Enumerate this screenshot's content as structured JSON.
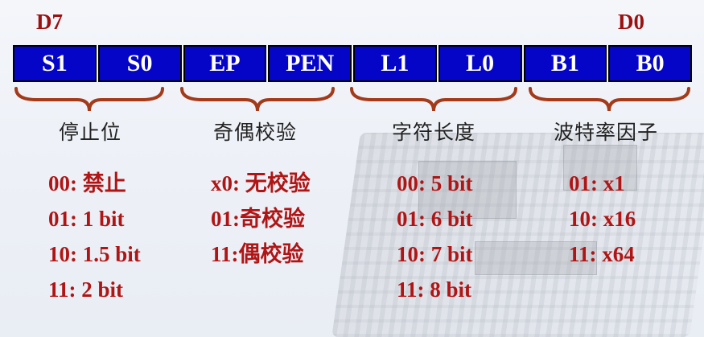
{
  "bit_labels": {
    "high": "D7",
    "low": "D0"
  },
  "register_fields": [
    "S1",
    "S0",
    "EP",
    "PEN",
    "L1",
    "L0",
    "B1",
    "B0"
  ],
  "groups": [
    {
      "title": "停止位",
      "values": [
        "00: 禁止",
        "01: 1 bit",
        "10: 1.5 bit",
        "11: 2 bit"
      ]
    },
    {
      "title": "奇偶校验",
      "values": [
        "x0: 无校验",
        "01:奇校验",
        "11:偶校验"
      ]
    },
    {
      "title": "字符长度",
      "values": [
        "00: 5 bit",
        "01: 6 bit",
        "10: 7 bit",
        "11: 8 bit"
      ]
    },
    {
      "title": "波特率因子",
      "values": [
        "01: x1",
        "10: x16",
        "11: x64"
      ]
    }
  ],
  "colors": {
    "register_fill": "#0505c8",
    "value_text": "#b01515",
    "bit_label": "#9b1010",
    "brace": "#a33a1a"
  }
}
